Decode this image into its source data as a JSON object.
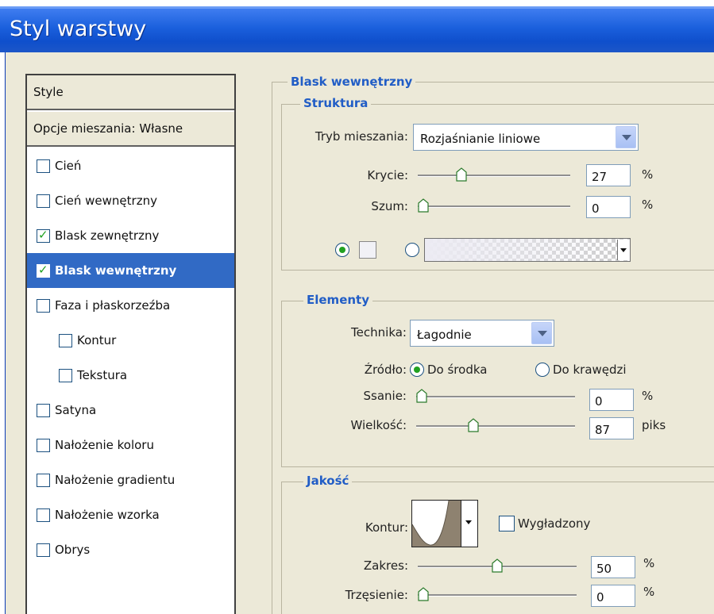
{
  "window": {
    "title": "Styl warstwy"
  },
  "style_list": {
    "header": "Style",
    "blending_options": "Opcje mieszania: Własne",
    "items": [
      {
        "label": "Cień",
        "checked": false,
        "selected": false
      },
      {
        "label": "Cień wewnętrzny",
        "checked": false,
        "selected": false
      },
      {
        "label": "Blask zewnętrzny",
        "checked": true,
        "selected": false
      },
      {
        "label": "Blask wewnętrzny",
        "checked": true,
        "selected": true
      },
      {
        "label": "Faza i płaskorzeźba",
        "checked": false,
        "selected": false
      },
      {
        "label": "Kontur",
        "checked": false,
        "selected": false
      },
      {
        "label": "Tekstura",
        "checked": false,
        "selected": false
      },
      {
        "label": "Satyna",
        "checked": false,
        "selected": false
      },
      {
        "label": "Nałożenie koloru",
        "checked": false,
        "selected": false
      },
      {
        "label": "Nałożenie gradientu",
        "checked": false,
        "selected": false
      },
      {
        "label": "Nałożenie wzorka",
        "checked": false,
        "selected": false
      },
      {
        "label": "Obrys",
        "checked": false,
        "selected": false
      }
    ]
  },
  "panel": {
    "title": "Blask wewnętrzny",
    "structure": {
      "legend": "Struktura",
      "blend_mode_label": "Tryb mieszania:",
      "blend_mode_value": "Rozjaśnianie liniowe",
      "opacity_label": "Krycie:",
      "opacity_value": "27",
      "opacity_unit": "%",
      "opacity_fraction": 0.27,
      "noise_label": "Szum:",
      "noise_value": "0",
      "noise_unit": "%",
      "noise_fraction": 0.0
    },
    "elements": {
      "legend": "Elementy",
      "technique_label": "Technika:",
      "technique_value": "Łagodnie",
      "source_label": "Źródło:",
      "source_center": "Do środka",
      "source_edge": "Do krawędzi",
      "choke_label": "Ssanie:",
      "choke_value": "0",
      "choke_unit": "%",
      "choke_fraction": 0.0,
      "size_label": "Wielkość:",
      "size_value": "87",
      "size_unit": "piks",
      "size_fraction": 0.35
    },
    "quality": {
      "legend": "Jakość",
      "contour_label": "Kontur:",
      "antialiased_label": "Wygładzony",
      "range_label": "Zakres:",
      "range_value": "50",
      "range_unit": "%",
      "range_fraction": 0.5,
      "jitter_label": "Trzęsienie:",
      "jitter_value": "0",
      "jitter_unit": "%",
      "jitter_fraction": 0.0
    }
  },
  "colors": {
    "title_bar": "#1a5fdc",
    "selection": "#316ac5",
    "legend_text": "#215dc6",
    "dialog_bg": "#ece9d8"
  }
}
